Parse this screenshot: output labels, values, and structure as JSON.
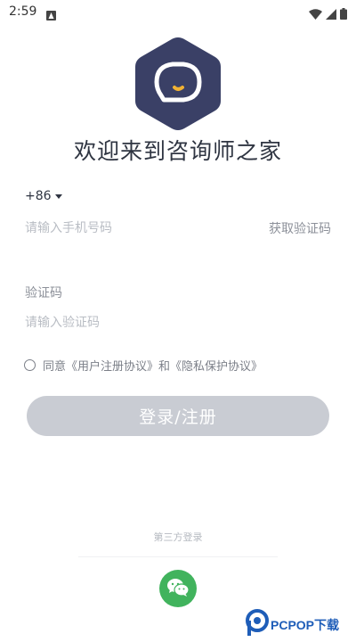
{
  "status_bar": {
    "time": "2:59"
  },
  "welcome": {
    "title": "欢迎来到咨询师之家"
  },
  "login_form": {
    "country_code": "+86",
    "phone_placeholder": "请输入手机号码",
    "get_code_label": "获取验证码",
    "code_label": "验证码",
    "code_placeholder": "请输入验证码"
  },
  "agreement": {
    "agree_text": "同意",
    "user_agreement": "《用户注册协议》",
    "and_text": "和",
    "privacy_policy": "《隐私保护协议》",
    "checked": false
  },
  "login_button": {
    "label": "登录/注册"
  },
  "third_party": {
    "label": "第三方登录",
    "providers": [
      "wechat"
    ]
  },
  "watermark": {
    "text": "PCPOP下载"
  },
  "colors": {
    "logo_hexagon": "#3a4066",
    "logo_accent": "#f2b233",
    "login_button_bg": "#c9ccd3",
    "wechat_green": "#41b35d",
    "watermark_blue": "#1e5db8"
  }
}
